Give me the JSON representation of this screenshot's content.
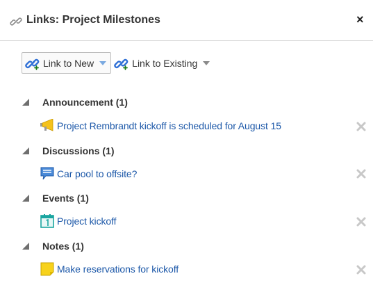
{
  "header": {
    "title": "Links: Project Milestones",
    "close_label": "×"
  },
  "toolbar": {
    "link_new_label": "Link to New",
    "link_existing_label": "Link to Existing"
  },
  "groups": [
    {
      "title": "Announcement (1)",
      "items": [
        {
          "text": "Project Rembrandt kickoff is scheduled for August 15",
          "icon": "megaphone-icon"
        }
      ]
    },
    {
      "title": "Discussions (1)",
      "items": [
        {
          "text": "Car pool to offsite?",
          "icon": "speech-bubble-icon"
        }
      ]
    },
    {
      "title": "Events (1)",
      "items": [
        {
          "text": "Project kickoff",
          "icon": "calendar-icon"
        }
      ]
    },
    {
      "title": "Notes (1)",
      "items": [
        {
          "text": "Make reservations for kickoff",
          "icon": "note-icon"
        }
      ]
    }
  ],
  "colors": {
    "link": "#1b57a8",
    "text": "#333333",
    "remove": "#c8c8c8",
    "accent_blue": "#2e6fd6"
  }
}
